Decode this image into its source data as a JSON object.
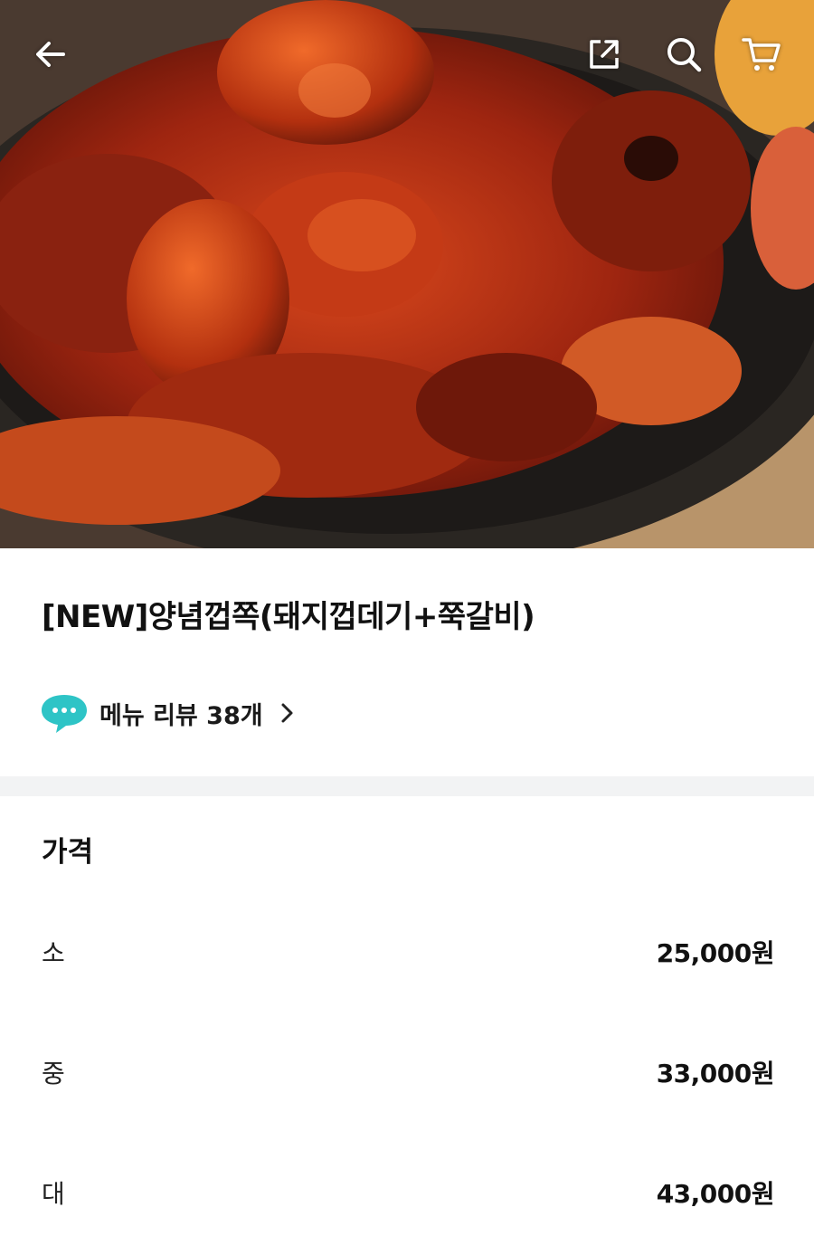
{
  "header": {
    "back_icon": "arrow-left-icon",
    "share_icon": "share-icon",
    "search_icon": "search-icon",
    "cart_icon": "cart-icon"
  },
  "menu": {
    "title": "[NEW]양념껍쪽(돼지껍데기+쭉갈비)",
    "review_icon": "chat-bubble-icon",
    "review_text": "메뉴 리뷰 38개"
  },
  "price": {
    "heading": "가격",
    "options": [
      {
        "size": "소",
        "amount": "25,000원"
      },
      {
        "size": "중",
        "amount": "33,000원"
      },
      {
        "size": "대",
        "amount": "43,000원"
      }
    ]
  },
  "colors": {
    "accent_bubble": "#2ec4c6",
    "divider": "#f2f3f4"
  }
}
